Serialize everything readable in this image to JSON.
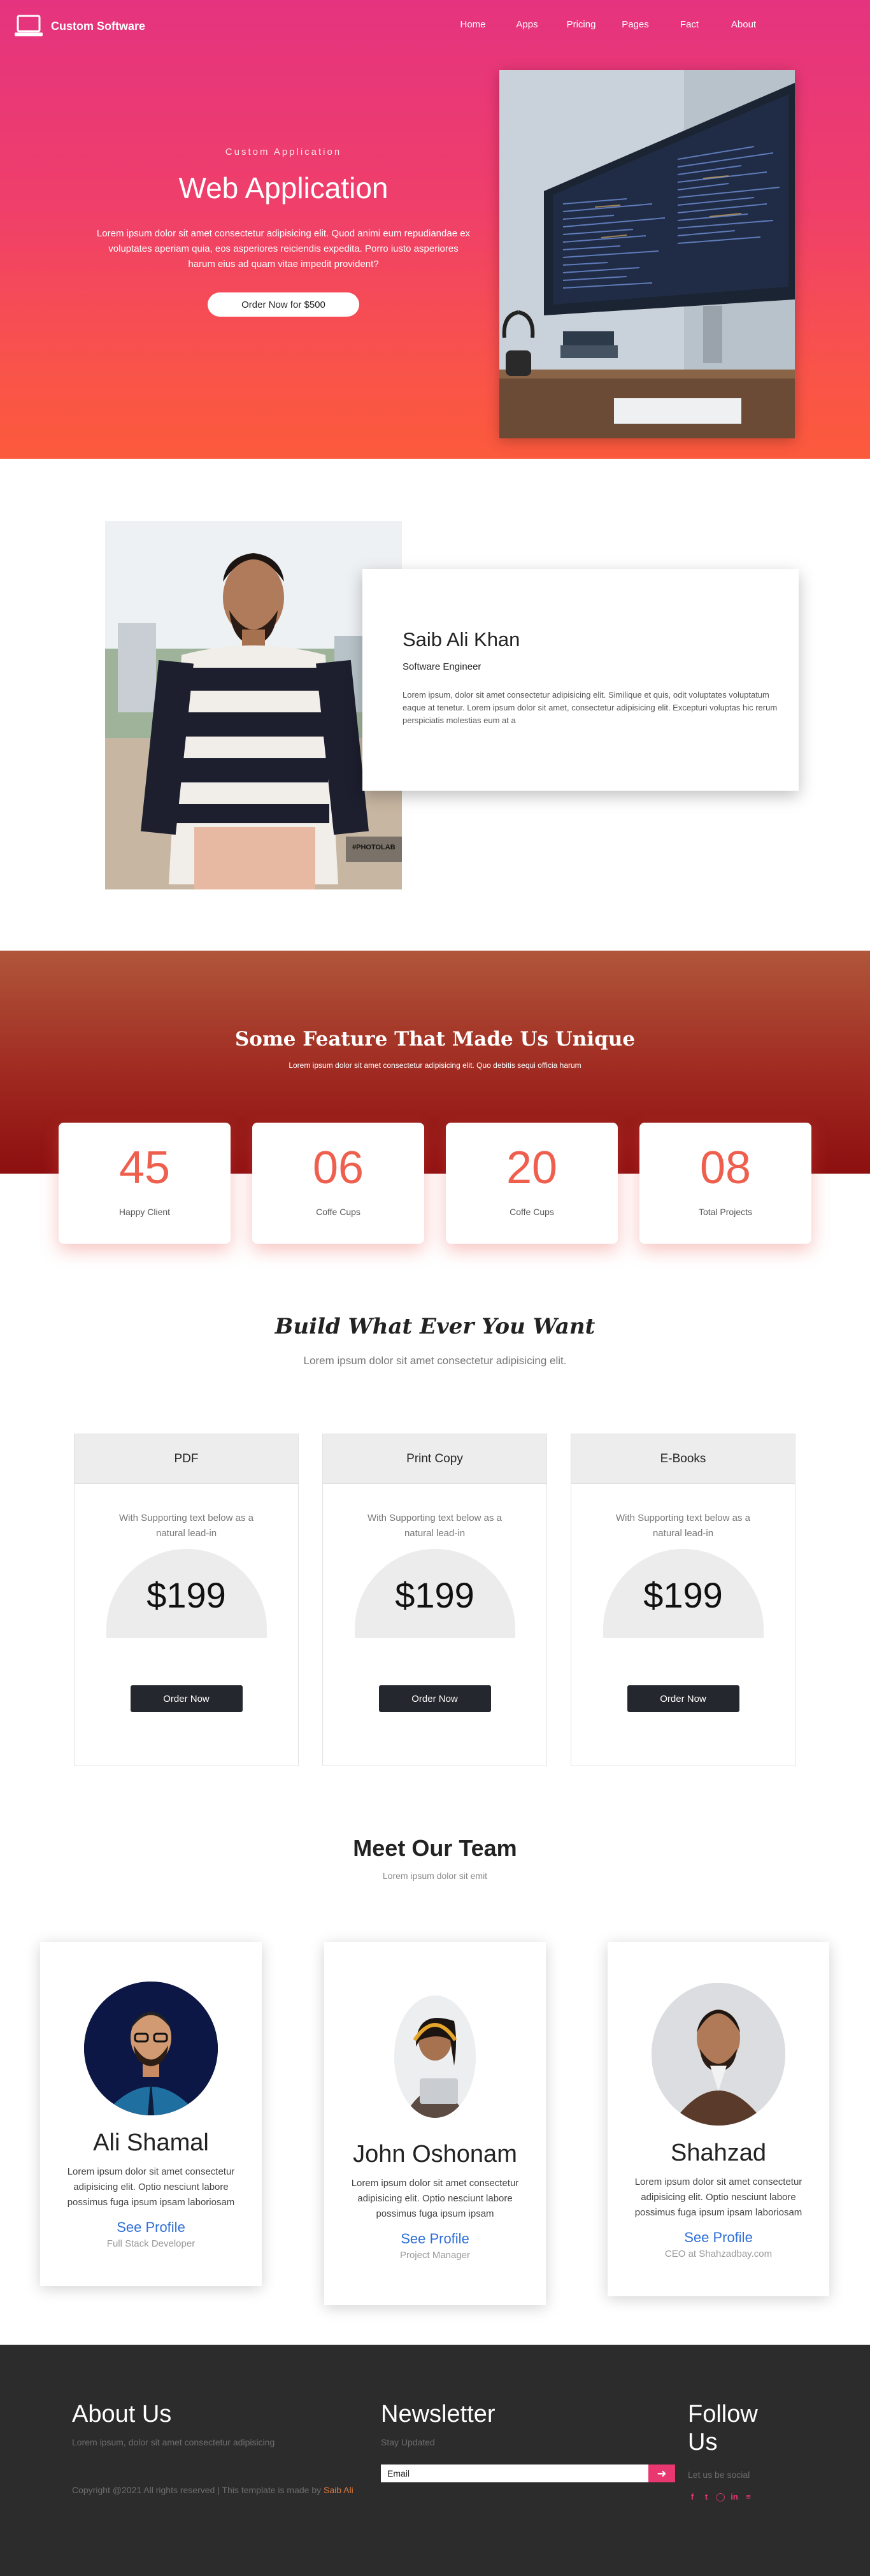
{
  "nav": {
    "brand": "Custom Software",
    "links": [
      "Home",
      "Apps",
      "Pricing",
      "Pages",
      "Fact",
      "About"
    ]
  },
  "hero": {
    "subtitle": "Custom Application",
    "title": "Web Application",
    "text": "Lorem ipsum dolor sit amet consectetur adipisicing elit. Quod animi eum repudiandae ex voluptates aperiam quia, eos asperiores reiciendis expedita. Porro iusto asperiores harum eius ad quam vitae impedit provident?",
    "button": "Order Now for $500"
  },
  "profile": {
    "name": "Saib Ali Khan",
    "role": "Software Engineer",
    "text": "Lorem ipsum, dolor sit amet consectetur adipisicing elit. Similique et quis, odit voluptates voluptatum eaque at tenetur. Lorem ipsum dolor sit amet, consectetur adipisicing elit. Excepturi voluptas hic rerum perspiciatis molestias eum at a",
    "watermark": "#PHOTOLAB"
  },
  "features": {
    "title": "Some Feature That Made Us Unique",
    "subtitle": "Lorem ipsum dolor sit amet consectetur adipisicing elit. Quo debitis sequi officia harum",
    "stats": [
      {
        "value": "45",
        "label": "Happy Client"
      },
      {
        "value": "06",
        "label": "Coffe Cups"
      },
      {
        "value": "20",
        "label": "Coffe Cups"
      },
      {
        "value": "08",
        "label": "Total Projects"
      }
    ]
  },
  "build": {
    "title": "Build What Ever You Want",
    "subtitle": "Lorem ipsum dolor sit amet consectetur adipisicing elit.",
    "plans": [
      {
        "name": "PDF",
        "text": "With Supporting text below as a natural lead-in",
        "price": "$199",
        "button": "Order Now"
      },
      {
        "name": "Print Copy",
        "text": "With Supporting text below as a natural lead-in",
        "price": "$199",
        "button": "Order Now"
      },
      {
        "name": "E-Books",
        "text": "With Supporting text below as a natural lead-in",
        "price": "$199",
        "button": "Order Now"
      }
    ]
  },
  "team": {
    "title": "Meet Our Team",
    "subtitle": "Lorem ipsum dolor sit emit",
    "members": [
      {
        "name": "Ali Shamal",
        "text": "Lorem ipsum dolor sit amet consectetur adipisicing elit. Optio nesciunt labore possimus fuga ipsum ipsam laboriosam",
        "link": "See Profile",
        "role": "Full Stack Developer"
      },
      {
        "name": "John Oshonam",
        "text": "Lorem ipsum dolor sit amet consectetur adipisicing elit. Optio nesciunt labore possimus fuga ipsum ipsam",
        "link": "See Profile",
        "role": "Project Manager"
      },
      {
        "name": "Shahzad",
        "text": "Lorem ipsum dolor sit amet consectetur adipisicing elit. Optio nesciunt labore possimus fuga ipsum ipsam laboriosam",
        "link": "See Profile",
        "role": "CEO at Shahzadbay.com"
      }
    ]
  },
  "footer": {
    "about_title": "About Us",
    "about_text": "Lorem ipsum, dolor sit amet consectetur adipisicing",
    "copyright": "Copyright @2021 All rights reserved | This template is made by",
    "author": "Saib Ali",
    "newsletter_title": "Newsletter",
    "newsletter_text": "Stay Updated",
    "email_placeholder": "Email",
    "follow_title_1": "Follow",
    "follow_title_2": "Us",
    "follow_text": "Let us be social"
  },
  "colors": {
    "hero_top": "#e5337f",
    "hero_bottom": "#fc5a3c",
    "stat_number": "#ef5f4e",
    "footer_bg": "#2c2c2d",
    "link_blue": "#2f6fd6",
    "social_pink": "#e8386f"
  },
  "icons": {
    "brand": "laptop-icon",
    "submit": "arrow-right-icon",
    "socials": [
      "facebook-icon",
      "twitter-icon",
      "instagram-icon",
      "linkedin-icon",
      "stackoverflow-icon"
    ]
  }
}
